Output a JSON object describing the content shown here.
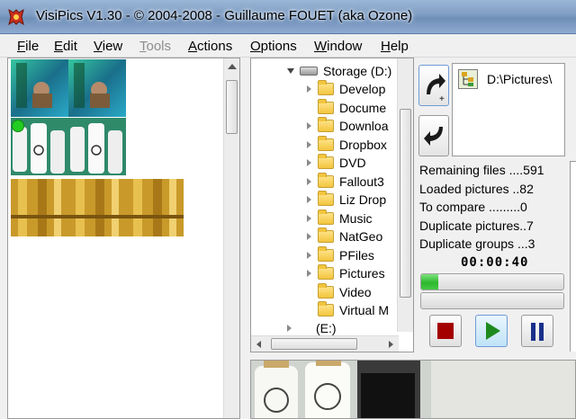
{
  "window": {
    "title": "VisiPics V1.30 - © 2004-2008 - Guillaume FOUET (aka Ozone)"
  },
  "menu": [
    {
      "label": "File",
      "underline": "F",
      "rest": "ile",
      "enabled": true
    },
    {
      "label": "Edit",
      "underline": "E",
      "rest": "dit",
      "enabled": true
    },
    {
      "label": "View",
      "underline": "V",
      "rest": "iew",
      "enabled": true
    },
    {
      "label": "Tools",
      "underline": "T",
      "rest": "ools",
      "enabled": false
    },
    {
      "label": "Actions",
      "underline": "A",
      "rest": "ctions",
      "enabled": true
    },
    {
      "label": "Options",
      "underline": "O",
      "rest": "ptions",
      "enabled": true
    },
    {
      "label": "Window",
      "underline": "W",
      "rest": "indow",
      "enabled": true
    },
    {
      "label": "Help",
      "underline": "H",
      "rest": "elp",
      "enabled": true
    }
  ],
  "tree": {
    "root": "Storage (D:)",
    "folders": [
      "Develop",
      "Docume",
      "Downloa",
      "Dropbox",
      "DVD",
      "Fallout3",
      "Liz Drop",
      "Music",
      "NatGeo",
      "PFiles",
      "Pictures",
      "Video",
      "Virtual M"
    ],
    "next_drive": "(E:)"
  },
  "path_list": {
    "items": [
      "D:\\Pictures\\"
    ]
  },
  "stats": {
    "remaining": "Remaining files ....591",
    "loaded": "Loaded pictures ..82",
    "to_compare": "To compare .........0",
    "duplicate_pictures": "Duplicate pictures..7",
    "duplicate_groups": "Duplicate groups ...3"
  },
  "timer": "00:00:40",
  "progress": {
    "scan_fraction": 0.12,
    "compare_fraction": 0.0
  },
  "colors": {
    "stop": "#a40000",
    "play": "#1e8a1e",
    "pause": "#1a2f8a",
    "selected_marker": "#22cc22"
  }
}
